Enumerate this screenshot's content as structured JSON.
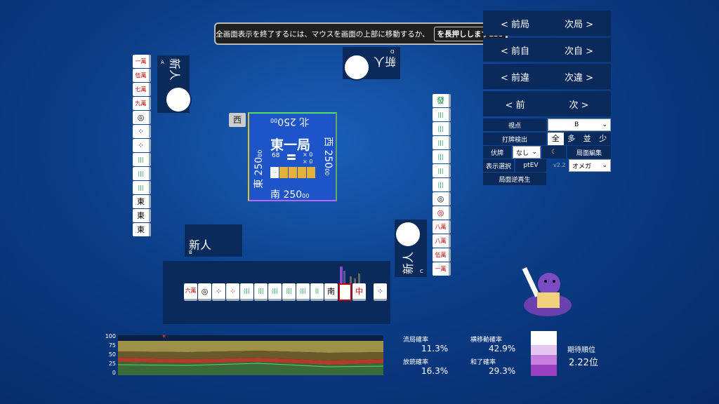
{
  "toast": {
    "text": "全画面表示を終了するには、マウスを画面の上部に移動するか、",
    "key": "を長押ししますEsc"
  },
  "players": {
    "west_name": "新人",
    "west_seat": "A",
    "north_name": "新人",
    "north_seat": "D",
    "south_name": "新人",
    "south_seat": "B",
    "east_name": "新人",
    "east_seat": "C"
  },
  "center": {
    "round": "東一局",
    "north": "北 250",
    "north_sub": "00",
    "east": "東 250",
    "east_sub": "00",
    "west": "西 250",
    "west_sub": "00",
    "south": "南 250",
    "south_sub": "00",
    "remaining": "68",
    "x1": "× 0",
    "x2": "× 0"
  },
  "dealer_marker": "西",
  "nav": {
    "prev_round": "< 前局",
    "next_round": "次局 >",
    "prev_self": "< 前自",
    "next_self": "次自 >",
    "prev_mistake": "< 前違",
    "next_mistake": "次違 >",
    "prev": "< 前",
    "next": "次 >"
  },
  "controls": {
    "viewpoint_label": "視点",
    "viewpoint_value": "B",
    "discard_detect": "打牌検出",
    "opt_all": "全",
    "opt_many": "多",
    "opt_mid": "並",
    "opt_few": "少",
    "hidden_label": "伏牌",
    "hidden_value": "なし",
    "moon": "☾",
    "edit": "局面編集",
    "display_select": "表示選択",
    "ptev": "ptEV",
    "version": "v2.2",
    "omega": "オメガ",
    "replay": "局面逆再生"
  },
  "hand_tiles": [
    "六萬",
    "◎",
    "⁘",
    "⁘",
    "|||",
    "|||",
    "|||",
    "|||",
    "|||",
    "||",
    "南",
    "",
    "中"
  ],
  "drawn_tile": "⁘",
  "west_river": [
    "一萬",
    "伍萬",
    "七萬",
    "九萬",
    "◎",
    "⁘",
    "⁘",
    "|||",
    "|||",
    "|||",
    "東",
    "東",
    "東"
  ],
  "east_river": [
    "發",
    "|||",
    "|||",
    "|||",
    "|||",
    "|||",
    "|||",
    "◎",
    "◎",
    "八萬",
    "八萬",
    "伍萬",
    "一萬"
  ],
  "graph": {
    "y_ticks": [
      "100",
      "75",
      "50",
      "25",
      "0"
    ]
  },
  "stats": {
    "ryukyoku_label": "流局確率",
    "ryukyoku_value": "11.3%",
    "yokoido_label": "横移動確率",
    "yokoido_value": "42.9%",
    "houju_label": "放銃確率",
    "houju_value": "16.3%",
    "hora_label": "和了確率",
    "hora_value": "29.3%",
    "rank_label": "期待順位",
    "rank_value": "2.22位"
  },
  "colors": {
    "panel": "#0a2a5c",
    "accent_purple": "#a64fc9"
  }
}
